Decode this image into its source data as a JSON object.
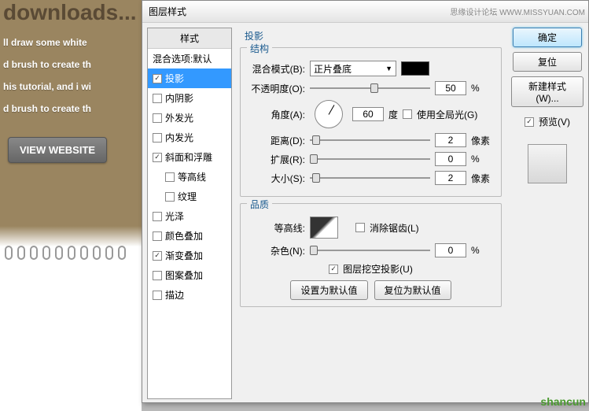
{
  "bg": {
    "title": "downloads...",
    "lines": [
      "ll draw some white",
      "d brush to create th",
      "his tutorial, and i wi",
      "d brush to create th"
    ],
    "view_btn": "VIEW WEBSITE"
  },
  "dialog": {
    "title": "图层样式",
    "styles_header": "样式",
    "blending_options": "混合选项:默认",
    "effects": {
      "drop_shadow": "投影",
      "inner_shadow": "内阴影",
      "outer_glow": "外发光",
      "inner_glow": "内发光",
      "bevel": "斜面和浮雕",
      "contour_sub": "等高线",
      "texture_sub": "纹理",
      "satin": "光泽",
      "color_overlay": "颜色叠加",
      "gradient_overlay": "渐变叠加",
      "pattern_overlay": "图案叠加",
      "stroke": "描边"
    },
    "panel_title": "投影",
    "struct_legend": "结构",
    "blend_mode_label": "混合模式(B):",
    "blend_mode_value": "正片叠底",
    "opacity_label": "不透明度(O):",
    "opacity_value": "50",
    "angle_label": "角度(A):",
    "angle_value": "60",
    "angle_unit": "度",
    "global_light": "使用全局光(G)",
    "distance_label": "距离(D):",
    "distance_value": "2",
    "px": "像素",
    "spread_label": "扩展(R):",
    "spread_value": "0",
    "pct": "%",
    "size_label": "大小(S):",
    "size_value": "2",
    "quality_legend": "品质",
    "contour_label": "等高线:",
    "anti_alias": "消除锯齿(L)",
    "noise_label": "杂色(N):",
    "noise_value": "0",
    "knockout": "图层挖空投影(U)",
    "set_default": "设置为默认值",
    "reset_default": "复位为默认值",
    "ok": "确定",
    "cancel": "复位",
    "new_style": "新建样式(W)...",
    "preview": "预览(V)"
  },
  "watermark": "思缘设计论坛  WWW.MISSYUAN.COM",
  "watermark2": "shancun"
}
